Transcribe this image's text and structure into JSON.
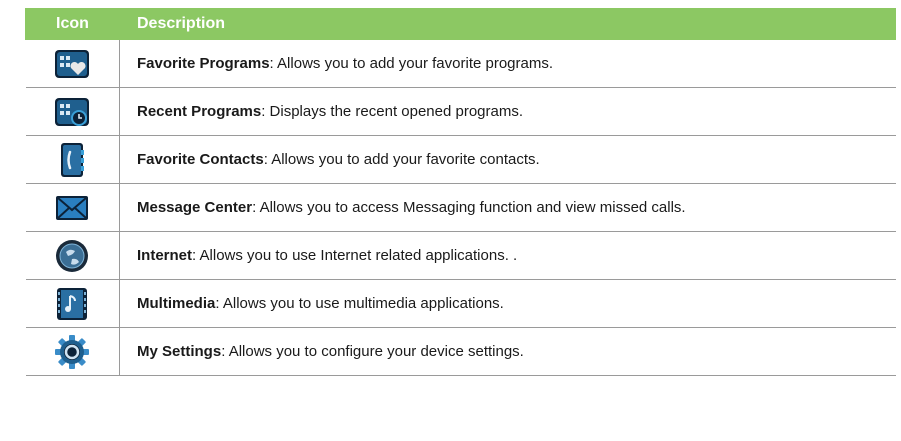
{
  "table": {
    "headers": {
      "icon": "Icon",
      "description": "Description"
    },
    "rows": [
      {
        "icon": "favorite-programs-icon",
        "title": "Favorite Programs",
        "text": ": Allows you to add your favorite programs."
      },
      {
        "icon": "recent-programs-icon",
        "title": "Recent Programs",
        "text": ": Displays the recent opened programs."
      },
      {
        "icon": "favorite-contacts-icon",
        "title": "Favorite Contacts",
        "text": ": Allows you to add your favorite contacts."
      },
      {
        "icon": "message-center-icon",
        "title": "Message Center",
        "text": ": Allows you to access Messaging function and view missed calls."
      },
      {
        "icon": "internet-icon",
        "title": "Internet",
        "text": ": Allows you to use Internet related applications. ."
      },
      {
        "icon": "multimedia-icon",
        "title": "Multimedia",
        "text": ": Allows you to use multimedia applications."
      },
      {
        "icon": "my-settings-icon",
        "title": "My Settings",
        "text": ": Allows you to configure your device settings."
      }
    ]
  },
  "colors": {
    "header": "#8cc863",
    "icon_dark": "#0c2238",
    "icon_accent": "#3aa0d8"
  }
}
